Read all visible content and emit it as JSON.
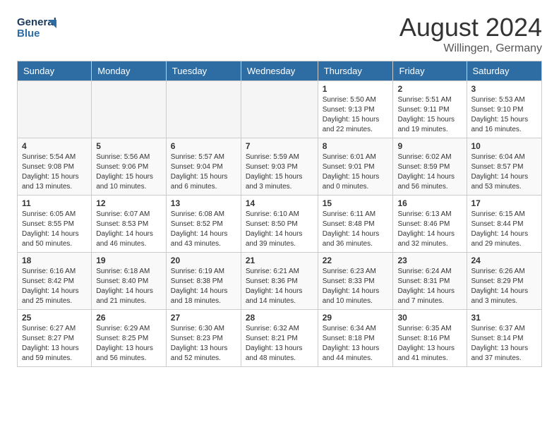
{
  "header": {
    "logo_line1": "General",
    "logo_line2": "Blue",
    "month_year": "August 2024",
    "location": "Willingen, Germany"
  },
  "days_of_week": [
    "Sunday",
    "Monday",
    "Tuesday",
    "Wednesday",
    "Thursday",
    "Friday",
    "Saturday"
  ],
  "weeks": [
    [
      {
        "day": "",
        "empty": true
      },
      {
        "day": "",
        "empty": true
      },
      {
        "day": "",
        "empty": true
      },
      {
        "day": "",
        "empty": true
      },
      {
        "day": "1",
        "sunrise": "5:50 AM",
        "sunset": "9:13 PM",
        "daylight": "15 hours and 22 minutes."
      },
      {
        "day": "2",
        "sunrise": "5:51 AM",
        "sunset": "9:11 PM",
        "daylight": "15 hours and 19 minutes."
      },
      {
        "day": "3",
        "sunrise": "5:53 AM",
        "sunset": "9:10 PM",
        "daylight": "15 hours and 16 minutes."
      }
    ],
    [
      {
        "day": "4",
        "sunrise": "5:54 AM",
        "sunset": "9:08 PM",
        "daylight": "15 hours and 13 minutes."
      },
      {
        "day": "5",
        "sunrise": "5:56 AM",
        "sunset": "9:06 PM",
        "daylight": "15 hours and 10 minutes."
      },
      {
        "day": "6",
        "sunrise": "5:57 AM",
        "sunset": "9:04 PM",
        "daylight": "15 hours and 6 minutes."
      },
      {
        "day": "7",
        "sunrise": "5:59 AM",
        "sunset": "9:03 PM",
        "daylight": "15 hours and 3 minutes."
      },
      {
        "day": "8",
        "sunrise": "6:01 AM",
        "sunset": "9:01 PM",
        "daylight": "15 hours and 0 minutes."
      },
      {
        "day": "9",
        "sunrise": "6:02 AM",
        "sunset": "8:59 PM",
        "daylight": "14 hours and 56 minutes."
      },
      {
        "day": "10",
        "sunrise": "6:04 AM",
        "sunset": "8:57 PM",
        "daylight": "14 hours and 53 minutes."
      }
    ],
    [
      {
        "day": "11",
        "sunrise": "6:05 AM",
        "sunset": "8:55 PM",
        "daylight": "14 hours and 50 minutes."
      },
      {
        "day": "12",
        "sunrise": "6:07 AM",
        "sunset": "8:53 PM",
        "daylight": "14 hours and 46 minutes."
      },
      {
        "day": "13",
        "sunrise": "6:08 AM",
        "sunset": "8:52 PM",
        "daylight": "14 hours and 43 minutes."
      },
      {
        "day": "14",
        "sunrise": "6:10 AM",
        "sunset": "8:50 PM",
        "daylight": "14 hours and 39 minutes."
      },
      {
        "day": "15",
        "sunrise": "6:11 AM",
        "sunset": "8:48 PM",
        "daylight": "14 hours and 36 minutes."
      },
      {
        "day": "16",
        "sunrise": "6:13 AM",
        "sunset": "8:46 PM",
        "daylight": "14 hours and 32 minutes."
      },
      {
        "day": "17",
        "sunrise": "6:15 AM",
        "sunset": "8:44 PM",
        "daylight": "14 hours and 29 minutes."
      }
    ],
    [
      {
        "day": "18",
        "sunrise": "6:16 AM",
        "sunset": "8:42 PM",
        "daylight": "14 hours and 25 minutes."
      },
      {
        "day": "19",
        "sunrise": "6:18 AM",
        "sunset": "8:40 PM",
        "daylight": "14 hours and 21 minutes."
      },
      {
        "day": "20",
        "sunrise": "6:19 AM",
        "sunset": "8:38 PM",
        "daylight": "14 hours and 18 minutes."
      },
      {
        "day": "21",
        "sunrise": "6:21 AM",
        "sunset": "8:36 PM",
        "daylight": "14 hours and 14 minutes."
      },
      {
        "day": "22",
        "sunrise": "6:23 AM",
        "sunset": "8:33 PM",
        "daylight": "14 hours and 10 minutes."
      },
      {
        "day": "23",
        "sunrise": "6:24 AM",
        "sunset": "8:31 PM",
        "daylight": "14 hours and 7 minutes."
      },
      {
        "day": "24",
        "sunrise": "6:26 AM",
        "sunset": "8:29 PM",
        "daylight": "14 hours and 3 minutes."
      }
    ],
    [
      {
        "day": "25",
        "sunrise": "6:27 AM",
        "sunset": "8:27 PM",
        "daylight": "13 hours and 59 minutes."
      },
      {
        "day": "26",
        "sunrise": "6:29 AM",
        "sunset": "8:25 PM",
        "daylight": "13 hours and 56 minutes."
      },
      {
        "day": "27",
        "sunrise": "6:30 AM",
        "sunset": "8:23 PM",
        "daylight": "13 hours and 52 minutes."
      },
      {
        "day": "28",
        "sunrise": "6:32 AM",
        "sunset": "8:21 PM",
        "daylight": "13 hours and 48 minutes."
      },
      {
        "day": "29",
        "sunrise": "6:34 AM",
        "sunset": "8:18 PM",
        "daylight": "13 hours and 44 minutes."
      },
      {
        "day": "30",
        "sunrise": "6:35 AM",
        "sunset": "8:16 PM",
        "daylight": "13 hours and 41 minutes."
      },
      {
        "day": "31",
        "sunrise": "6:37 AM",
        "sunset": "8:14 PM",
        "daylight": "13 hours and 37 minutes."
      }
    ]
  ]
}
